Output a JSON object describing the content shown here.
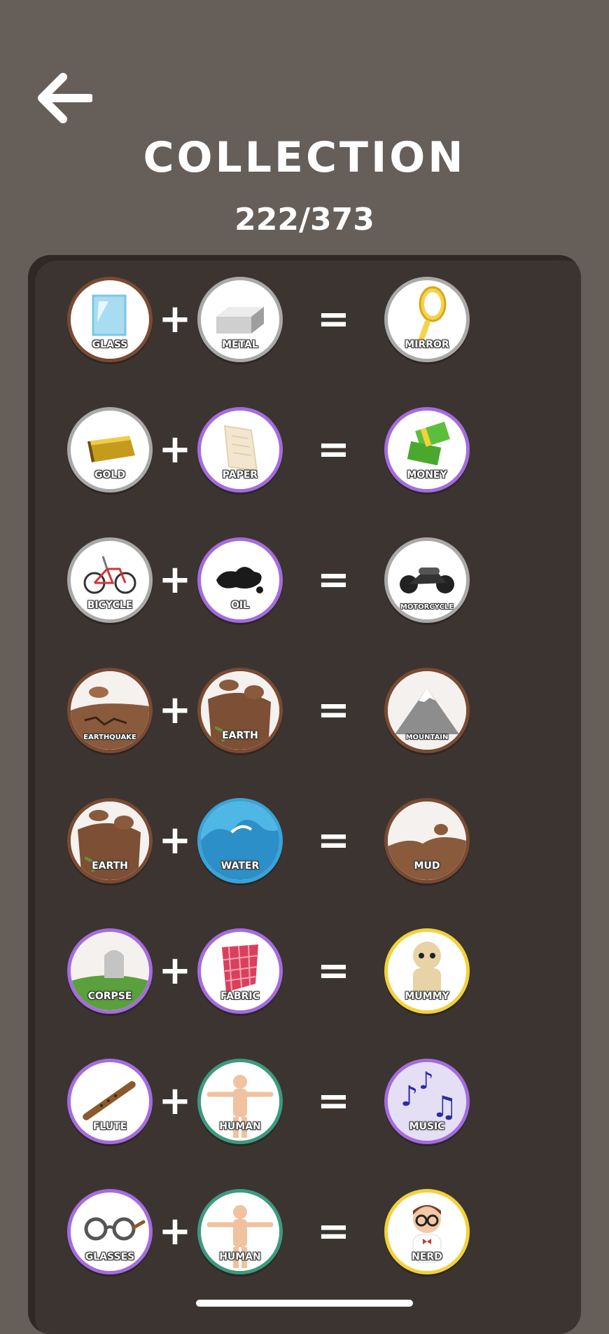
{
  "header": {
    "title": "COLLECTION",
    "count": "222/373"
  },
  "colors": {
    "background": "#665e59",
    "panel": "#3c3430",
    "ring_gray": "#a9a9a9",
    "ring_brown": "#7a4a33",
    "ring_purple": "#a56be0",
    "ring_teal": "#3d9a7e",
    "ring_yellow": "#f2d23a",
    "ring_blue": "#3aa3d8"
  },
  "recipes": [
    {
      "a": "GLASS",
      "b": "METAL",
      "result": "MIRROR"
    },
    {
      "a": "GOLD",
      "b": "PAPER",
      "result": "MONEY"
    },
    {
      "a": "BICYCLE",
      "b": "OIL",
      "result": "MOTORCYCLE"
    },
    {
      "a": "EARTHQUAKE",
      "b": "EARTH",
      "result": "MOUNTAIN"
    },
    {
      "a": "EARTH",
      "b": "WATER",
      "result": "MUD"
    },
    {
      "a": "CORPSE",
      "b": "FABRIC",
      "result": "MUMMY"
    },
    {
      "a": "FLUTE",
      "b": "HUMAN",
      "result": "MUSIC"
    },
    {
      "a": "GLASSES",
      "b": "HUMAN",
      "result": "NERD"
    }
  ],
  "operators": {
    "plus": "+",
    "equals": "="
  }
}
